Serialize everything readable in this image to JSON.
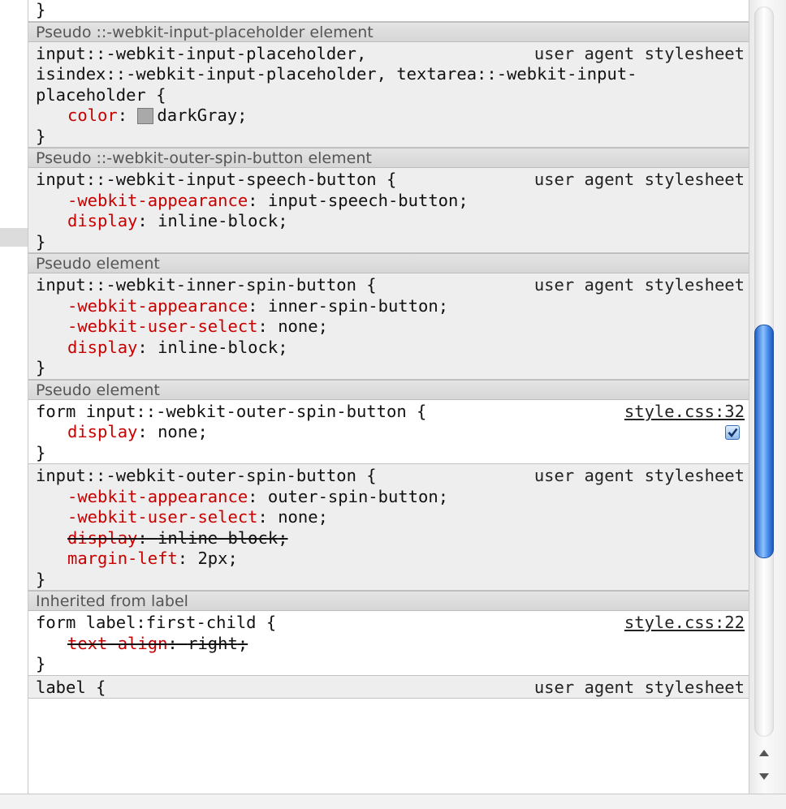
{
  "blocks": [
    {
      "type": "rule",
      "bg": "white",
      "first": true,
      "selector": [],
      "source": "",
      "link": false,
      "props": [],
      "closer": "}"
    },
    {
      "type": "header",
      "label": "Pseudo ::-webkit-input-placeholder element"
    },
    {
      "type": "rule",
      "selector": [
        "input::-webkit-input-placeholder,",
        "isindex::-webkit-input-placeholder, textarea::-webkit-input-",
        "placeholder {"
      ],
      "source": "user agent stylesheet",
      "link": false,
      "props": [
        {
          "name": "color",
          "value": "darkGray",
          "swatch": "#a9a9a9",
          "struck": false
        }
      ],
      "closer": "}"
    },
    {
      "type": "header",
      "label": "Pseudo ::-webkit-outer-spin-button element"
    },
    {
      "type": "rule",
      "selector": [
        "input::-webkit-input-speech-button {"
      ],
      "source": "user agent stylesheet",
      "link": false,
      "props": [
        {
          "name": "-webkit-appearance",
          "value": "input-speech-button",
          "struck": false
        },
        {
          "name": "display",
          "value": "inline-block",
          "struck": false
        }
      ],
      "closer": "}"
    },
    {
      "type": "header",
      "label": "Pseudo element"
    },
    {
      "type": "rule",
      "selector": [
        "input::-webkit-inner-spin-button {"
      ],
      "source": "user agent stylesheet",
      "link": false,
      "props": [
        {
          "name": "-webkit-appearance",
          "value": "inner-spin-button",
          "struck": false
        },
        {
          "name": "-webkit-user-select",
          "value": "none",
          "struck": false
        },
        {
          "name": "display",
          "value": "inline-block",
          "struck": false
        }
      ],
      "closer": "}"
    },
    {
      "type": "header",
      "label": "Pseudo element"
    },
    {
      "type": "rule",
      "bg": "white",
      "selector": [
        "form input::-webkit-outer-spin-button {"
      ],
      "source": "style.css:32",
      "link": true,
      "props": [
        {
          "name": "display",
          "value": "none",
          "struck": false,
          "checkbox": true
        }
      ],
      "closer": "}"
    },
    {
      "type": "rule",
      "selector": [
        "input::-webkit-outer-spin-button {"
      ],
      "source": "user agent stylesheet",
      "link": false,
      "props": [
        {
          "name": "-webkit-appearance",
          "value": "outer-spin-button",
          "struck": false
        },
        {
          "name": "-webkit-user-select",
          "value": "none",
          "struck": false
        },
        {
          "name": "display",
          "value": "inline-block",
          "struck": true
        },
        {
          "name": "margin-left",
          "value": "2px",
          "struck": false
        }
      ],
      "closer": "}"
    },
    {
      "type": "header",
      "label": "Inherited from label"
    },
    {
      "type": "rule",
      "bg": "white",
      "selector": [
        "form label:first-child {"
      ],
      "source": "style.css:22",
      "link": true,
      "props": [
        {
          "name": "text-align",
          "value": "right",
          "struck": true
        }
      ],
      "closer": "}"
    },
    {
      "type": "rule",
      "selector": [
        "label {"
      ],
      "source": "user agent stylesheet",
      "link": false,
      "props": [],
      "closer": ""
    }
  ],
  "colors": {
    "property_name": "#c80000",
    "link_text": "#222222",
    "scroll_thumb": "#3f86e8"
  },
  "icons": {
    "up": "up-arrow-icon",
    "down": "down-arrow-icon",
    "check": "checkmark-icon"
  }
}
